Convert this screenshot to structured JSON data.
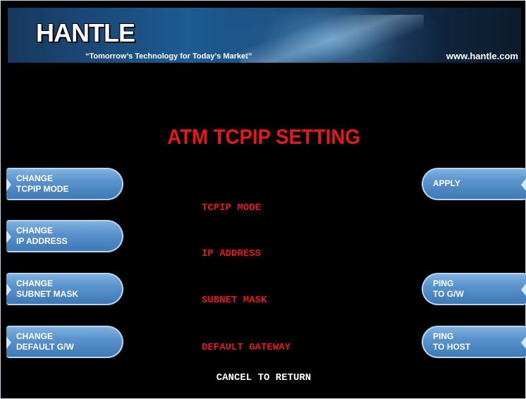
{
  "header": {
    "logo_text": "HANTLE",
    "tagline": "“Tomorrow’s Technology for Today’s Market”",
    "website": "www.hantle.com"
  },
  "screen_title": "ATM TCPIP SETTING",
  "left_buttons": [
    {
      "line1": "CHANGE",
      "line2": "TCPIP MODE"
    },
    {
      "line1": "CHANGE",
      "line2": "IP ADDRESS"
    },
    {
      "line1": "CHANGE",
      "line2": "SUBNET MASK"
    },
    {
      "line1": "CHANGE",
      "line2": "DEFAULT G/W"
    }
  ],
  "right_buttons": [
    {
      "line1": "APPLY",
      "line2": ""
    },
    {
      "line1": "PING",
      "line2": "TO G/W"
    },
    {
      "line1": "PING",
      "line2": "TO HOST"
    }
  ],
  "fields": {
    "tcpip_mode_label": "TCPIP MODE",
    "ip_address_label": "IP ADDRESS",
    "subnet_mask_label": "SUBNET MASK",
    "default_gateway_label": "DEFAULT GATEWAY"
  },
  "footer_text": "CANCEL TO RETURN",
  "colors": {
    "background": "#000000",
    "title_red": "#e3191b",
    "button_blue": "#5a93cc"
  }
}
